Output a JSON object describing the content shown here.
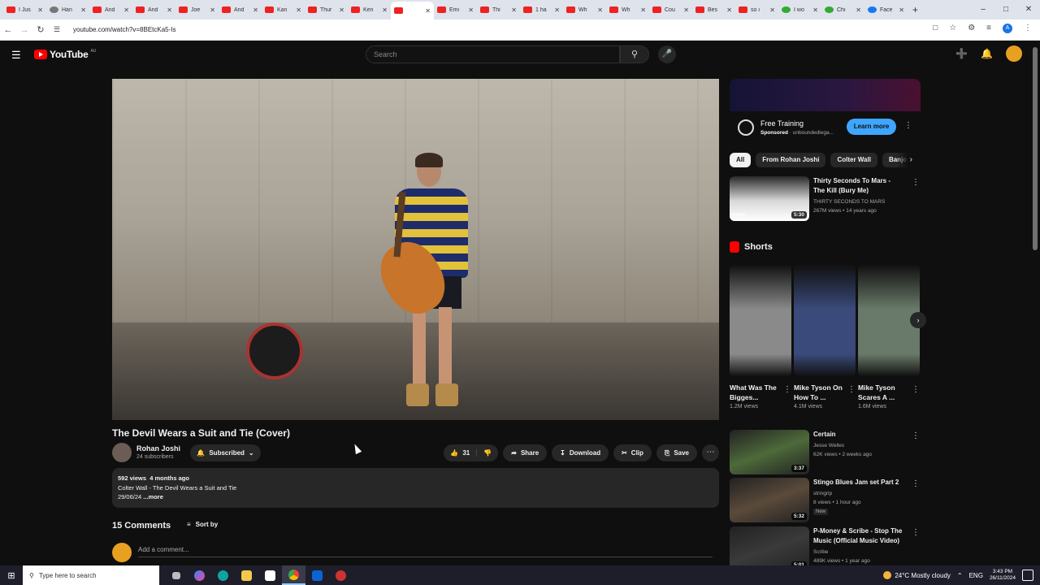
{
  "browser": {
    "tabs": [
      {
        "label": "I Jus",
        "icon": "youtube-icon"
      },
      {
        "label": "Han",
        "icon": "globe-icon"
      },
      {
        "label": "And",
        "icon": "youtube-icon"
      },
      {
        "label": "And",
        "icon": "youtube-icon"
      },
      {
        "label": "Joe",
        "icon": "youtube-icon"
      },
      {
        "label": "And",
        "icon": "youtube-icon"
      },
      {
        "label": "Kan",
        "icon": "youtube-icon"
      },
      {
        "label": "Thur",
        "icon": "youtube-icon"
      },
      {
        "label": "Ken",
        "icon": "youtube-icon"
      },
      {
        "label": "",
        "icon": "youtube-icon",
        "active": true
      },
      {
        "label": "Emi",
        "icon": "youtube-icon"
      },
      {
        "label": "Thi",
        "icon": "youtube-icon"
      },
      {
        "label": "1 ha",
        "icon": "youtube-icon"
      },
      {
        "label": "Wh",
        "icon": "youtube-icon"
      },
      {
        "label": "Wh",
        "icon": "youtube-icon"
      },
      {
        "label": "Cou",
        "icon": "youtube-icon"
      },
      {
        "label": "Bes",
        "icon": "youtube-icon"
      },
      {
        "label": "so i",
        "icon": "youtube-icon"
      },
      {
        "label": "I wo",
        "icon": "chatgpt-icon"
      },
      {
        "label": "Chi",
        "icon": "chatgpt-icon"
      },
      {
        "label": "Face",
        "icon": "facebook-icon"
      }
    ],
    "url": "youtube.com/watch?v=8BEtcKa5-Is",
    "profile_initial": "A"
  },
  "youtube": {
    "logo_text": "YouTube",
    "country_code": "AU",
    "search_placeholder": "Search"
  },
  "video": {
    "title": "The Devil Wears a Suit and Tie (Cover)",
    "channel": "Rohan Joshi",
    "subscribers": "24 subscribers",
    "subscribe_label": "Subscribed",
    "likes": "31",
    "share_label": "Share",
    "download_label": "Download",
    "clip_label": "Clip",
    "save_label": "Save",
    "views": "592 views",
    "age": "4 months ago",
    "desc_line1": "Colter Wall - The Devil Wears a Suit and Tie",
    "desc_line2": "29/06/24",
    "more_label": "...more"
  },
  "comments": {
    "count": "15 Comments",
    "sort_label": "Sort by",
    "placeholder": "Add a comment..."
  },
  "ad": {
    "title": "Free Training",
    "sponsored": "Sponsored",
    "domain": "unboundedlega...",
    "cta": "Learn more"
  },
  "chips": [
    "All",
    "From Rohan Joshi",
    "Colter Wall",
    "Banjo"
  ],
  "related_top": {
    "title": "Thirty Seconds To Mars - The Kill (Bury Me)",
    "channel": "THIRTY SECONDS TO MARS",
    "meta": "267M views • 14 years ago",
    "duration": "5:30",
    "brand": "vevo"
  },
  "shorts_header": "Shorts",
  "shorts": [
    {
      "title": "What Was The Bigges...",
      "views": "1.2M views",
      "thumb_color": "#8a8a8a"
    },
    {
      "title": "Mike Tyson On How To ...",
      "views": "4.1M views",
      "thumb_color": "#3a4a7a"
    },
    {
      "title": "Mike Tyson Scares A ...",
      "views": "1.6M views",
      "thumb_color": "#6a7a6a"
    }
  ],
  "related": [
    {
      "title": "Certain",
      "channel": "Jesse Welles",
      "meta": "62K views • 2 weeks ago",
      "duration": "3:37",
      "badge": "",
      "thumb_color": "#4d6a3a"
    },
    {
      "title": "Stingo Blues Jam set Part 2",
      "channel": "stringrip",
      "meta": "8 views • 1 hour ago",
      "duration": "5:32",
      "badge": "New",
      "thumb_color": "#5a4a3a"
    },
    {
      "title": "P-Money & Scribe - Stop The Music (Official Music Video)",
      "channel": "Scribe",
      "meta": "489K views • 1 year ago",
      "duration": "5:01",
      "badge": "",
      "thumb_color": "#3a3a3a"
    }
  ],
  "taskbar": {
    "search_placeholder": "Type here to search",
    "weather": "24°C  Mostly cloudy",
    "lang": "ENG",
    "time": "3:43 PM",
    "date": "26/11/2024"
  }
}
